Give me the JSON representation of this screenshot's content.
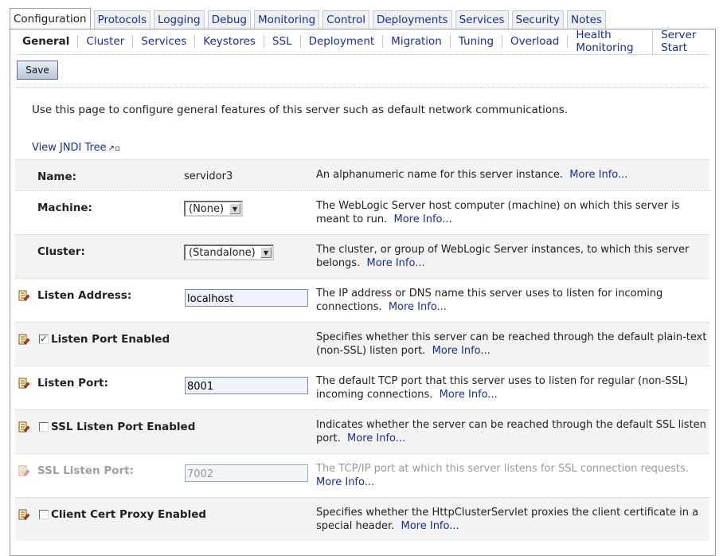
{
  "tabs": [
    "Configuration",
    "Protocols",
    "Logging",
    "Debug",
    "Monitoring",
    "Control",
    "Deployments",
    "Services",
    "Security",
    "Notes"
  ],
  "subtabs": [
    "General",
    "Cluster",
    "Services",
    "Keystores",
    "SSL",
    "Deployment",
    "Migration",
    "Tuning",
    "Overload",
    "Health Monitoring",
    "Server Start"
  ],
  "save_label": "Save",
  "intro": "Use this page to configure general features of this server such as default network communications.",
  "jndi_link": "View JNDI Tree",
  "fields": {
    "name": {
      "label": "Name:",
      "value": "servidor3",
      "help": "An alphanumeric name for this server instance.",
      "more": "More Info..."
    },
    "machine": {
      "label": "Machine:",
      "value": "(None)",
      "help": "The WebLogic Server host computer (machine) on which this server is meant to run.",
      "more": "More Info..."
    },
    "cluster": {
      "label": "Cluster:",
      "value": "(Standalone)",
      "help": "The cluster, or group of WebLogic Server instances, to which this server belongs.",
      "more": "More Info..."
    },
    "listen_address": {
      "label": "Listen Address:",
      "value": "localhost",
      "help": "The IP address or DNS name this server uses to listen for incoming connections.",
      "more": "More Info..."
    },
    "listen_port_enabled": {
      "label": "Listen Port Enabled",
      "checked": true,
      "help": "Specifies whether this server can be reached through the default plain-text (non-SSL) listen port.",
      "more": "More Info..."
    },
    "listen_port": {
      "label": "Listen Port:",
      "value": "8001",
      "help": "The default TCP port that this server uses to listen for regular (non-SSL) incoming connections.",
      "more": "More Info..."
    },
    "ssl_listen_port_enabled": {
      "label": "SSL Listen Port Enabled",
      "checked": false,
      "help": "Indicates whether the server can be reached through the default SSL listen port.",
      "more": "More Info..."
    },
    "ssl_listen_port": {
      "label": "SSL Listen Port:",
      "value": "7002",
      "disabled": true,
      "help": "The TCP/IP port at which this server listens for SSL connection requests.",
      "more": "More Info..."
    },
    "client_cert_proxy_enabled": {
      "label": "Client Cert Proxy Enabled",
      "checked": false,
      "help": "Specifies whether the HttpClusterServlet proxies the client certificate in a special header.",
      "more": "More Info..."
    }
  },
  "checkmark": "✓",
  "colors": {
    "link": "#1a2d9c",
    "shade": "#f3f3f3",
    "border": "#9aa0aa"
  }
}
